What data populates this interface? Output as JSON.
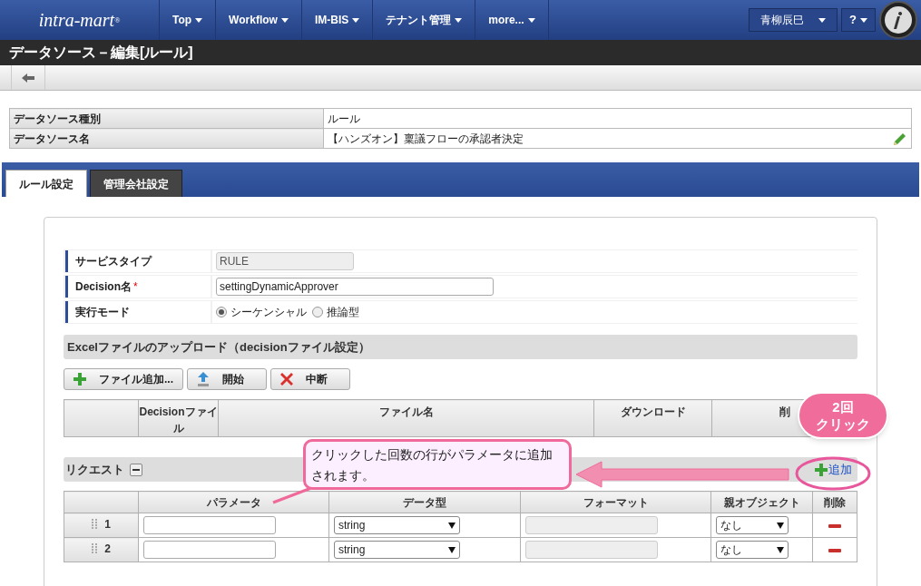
{
  "header": {
    "logo": "intra-mart",
    "logo_mark": "®",
    "menus": [
      "Top",
      "Workflow",
      "IM-BIS",
      "テナント管理",
      "more..."
    ],
    "user": "青柳辰巳",
    "help": "?"
  },
  "page_title": "データソース－編集[ルール]",
  "info": [
    {
      "label": "データソース種別",
      "value": "ルール",
      "editable": false
    },
    {
      "label": "データソース名",
      "value": "【ハンズオン】稟議フローの承認者決定",
      "editable": true
    }
  ],
  "tabs": [
    {
      "label": "ルール設定",
      "selected": true
    },
    {
      "label": "管理会社設定",
      "selected": false
    }
  ],
  "form": {
    "service_type": {
      "label": "サービスタイプ",
      "value": "RULE"
    },
    "decision_name": {
      "label": "Decision名",
      "required_mark": "*",
      "value": "settingDynamicApprover"
    },
    "exec_mode": {
      "label": "実行モード",
      "options": [
        {
          "label": "シーケンシャル",
          "selected": true
        },
        {
          "label": "推論型",
          "selected": false
        }
      ]
    }
  },
  "upload": {
    "title": "Excelファイルのアップロード（decisionファイル設定）",
    "buttons": [
      {
        "label": "ファイル追加...",
        "kind": "add"
      },
      {
        "label": "開始",
        "kind": "upload"
      },
      {
        "label": "中断",
        "kind": "cancel"
      }
    ],
    "columns": [
      "Decisionファイル",
      "ファイル名",
      "ダウンロード",
      "削"
    ]
  },
  "request": {
    "title": "リクエスト",
    "add_button": "追加",
    "columns": [
      "パラメータ",
      "データ型",
      "フォーマット",
      "親オブジェクト",
      "削除"
    ],
    "rows": [
      {
        "index": "1",
        "data_type": "string",
        "parent": "なし"
      },
      {
        "index": "2",
        "data_type": "string",
        "parent": "なし"
      }
    ]
  },
  "annotations": {
    "callout": "クリックした回数の行がパラメータに追加されます。",
    "badge_lines": [
      "2回",
      "クリック"
    ]
  }
}
